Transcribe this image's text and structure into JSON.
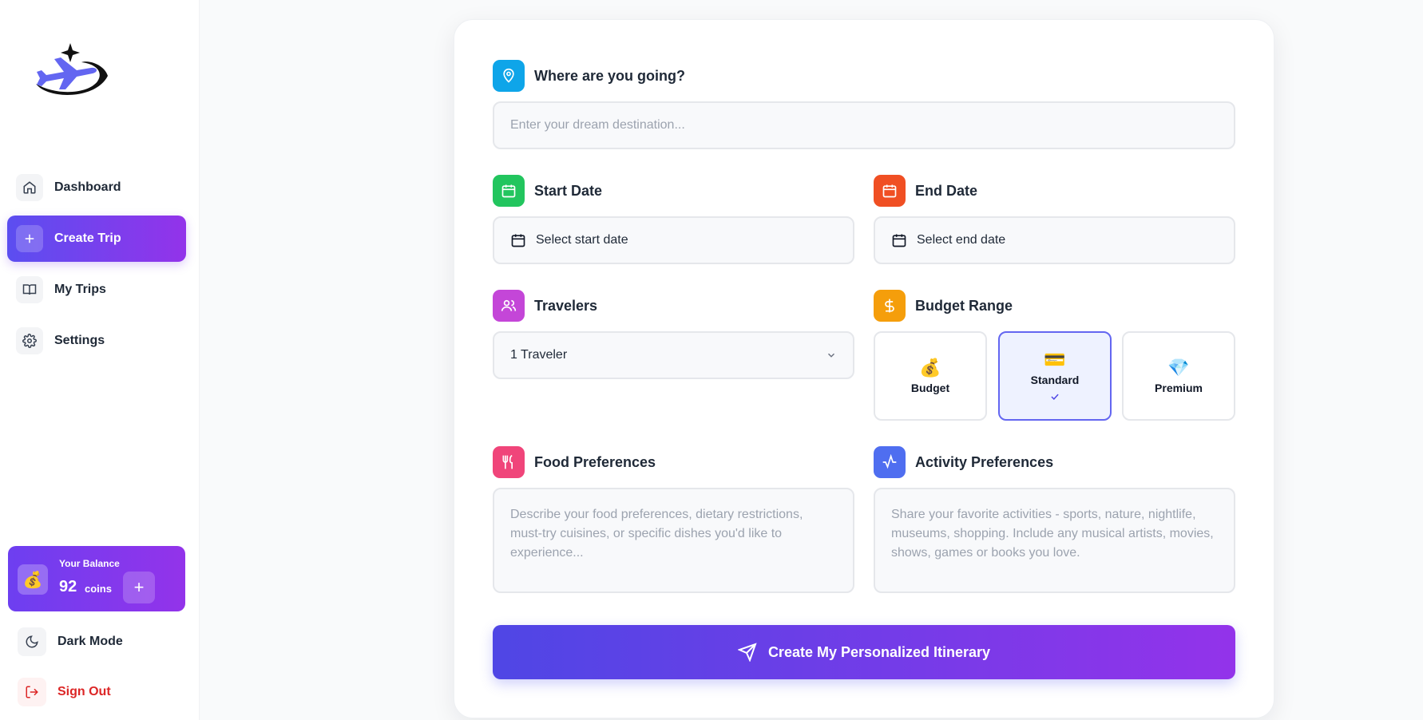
{
  "sidebar": {
    "items": [
      {
        "label": "Dashboard",
        "icon": "home-icon"
      },
      {
        "label": "Create Trip",
        "icon": "plus-icon"
      },
      {
        "label": "My Trips",
        "icon": "book-icon"
      },
      {
        "label": "Settings",
        "icon": "gear-icon"
      }
    ],
    "balance": {
      "label": "Your Balance",
      "amount": "92",
      "unit": "coins",
      "add": "+"
    },
    "dark_mode": "Dark Mode",
    "sign_out": "Sign Out"
  },
  "form": {
    "destination": {
      "label": "Where are you going?",
      "placeholder": "Enter your dream destination..."
    },
    "start_date": {
      "label": "Start Date",
      "value": "Select start date"
    },
    "end_date": {
      "label": "End Date",
      "value": "Select end date"
    },
    "travelers": {
      "label": "Travelers",
      "value": "1 Traveler"
    },
    "budget": {
      "label": "Budget Range",
      "options": [
        {
          "label": "Budget",
          "emoji": "💰"
        },
        {
          "label": "Standard",
          "emoji": "💳"
        },
        {
          "label": "Premium",
          "emoji": "💎"
        }
      ],
      "selected": "Standard"
    },
    "food": {
      "label": "Food Preferences",
      "placeholder": "Describe your food preferences, dietary restrictions, must-try cuisines, or specific dishes you'd like to experience..."
    },
    "activity": {
      "label": "Activity Preferences",
      "placeholder": "Share your favorite activities - sports, nature, nightlife, museums, shopping. Include any musical artists, movies, shows, games or books you love."
    },
    "submit": "Create My Personalized Itinerary"
  },
  "colors": {
    "accent": "#6366f1",
    "accent_gradient_start": "#4f46e5",
    "accent_gradient_end": "#9333ea",
    "sign_out": "#dc2626"
  }
}
